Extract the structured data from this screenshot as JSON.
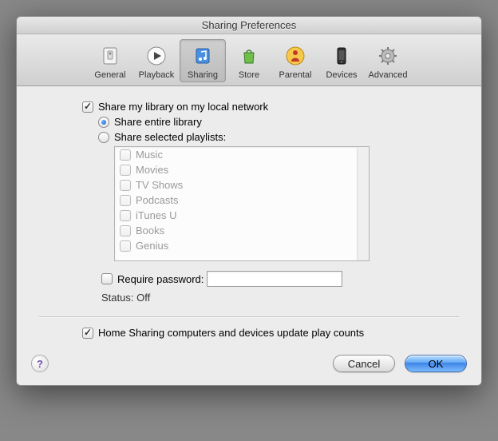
{
  "window": {
    "title": "Sharing Preferences"
  },
  "toolbar": {
    "items": [
      {
        "label": "General"
      },
      {
        "label": "Playback"
      },
      {
        "label": "Sharing"
      },
      {
        "label": "Store"
      },
      {
        "label": "Parental"
      },
      {
        "label": "Devices"
      },
      {
        "label": "Advanced"
      }
    ],
    "selected_index": 2
  },
  "share_library": {
    "label": "Share my library on my local network",
    "checked": true
  },
  "share_mode": {
    "entire_label": "Share entire library",
    "selected_label": "Share selected playlists:",
    "value": "entire"
  },
  "playlists": [
    {
      "label": "Music",
      "checked": false
    },
    {
      "label": "Movies",
      "checked": false
    },
    {
      "label": "TV Shows",
      "checked": false
    },
    {
      "label": "Podcasts",
      "checked": false
    },
    {
      "label": "iTunes U",
      "checked": false
    },
    {
      "label": "Books",
      "checked": false
    },
    {
      "label": "Genius",
      "checked": false
    }
  ],
  "require_password": {
    "label": "Require password:",
    "checked": false,
    "value": ""
  },
  "status": {
    "label": "Status:",
    "value": "Off"
  },
  "home_sharing": {
    "label": "Home Sharing computers and devices update play counts",
    "checked": true
  },
  "buttons": {
    "cancel": "Cancel",
    "ok": "OK"
  },
  "help_glyph": "?"
}
